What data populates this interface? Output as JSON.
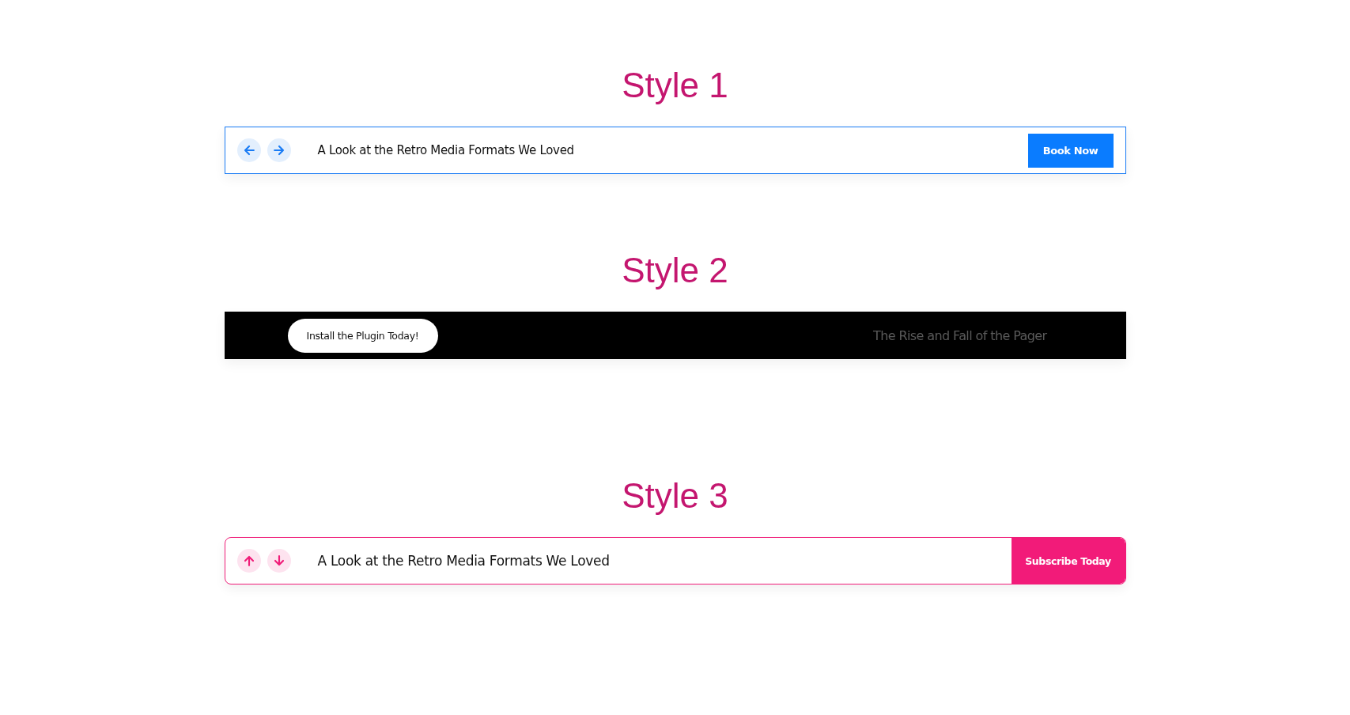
{
  "sections": [
    {
      "title": "Style 1",
      "kind": "blue-bar",
      "headline": "A Look at the Retro Media Formats We Loved",
      "button": "Book Now"
    },
    {
      "title": "Style 2",
      "kind": "dark-pill",
      "headline": "The Rise and Fall of the Pager",
      "button": "Install the Plugin Today!"
    },
    {
      "title": "Style 3",
      "kind": "pink-bar",
      "headline": "A Look at the Retro Media Formats We Loved",
      "button": "Subscribe Today"
    }
  ]
}
